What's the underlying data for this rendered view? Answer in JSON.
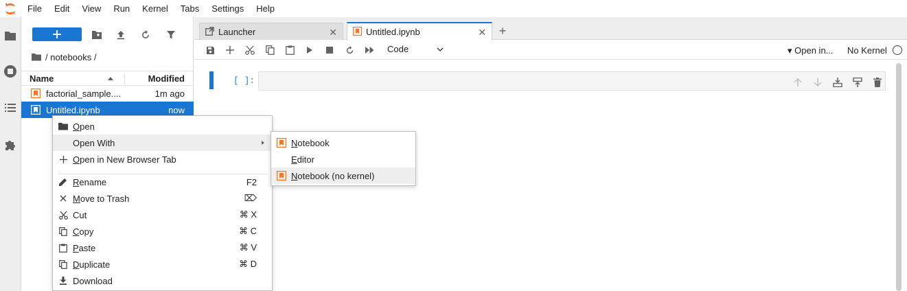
{
  "menubar": {
    "items": [
      "File",
      "Edit",
      "View",
      "Run",
      "Kernel",
      "Tabs",
      "Settings",
      "Help"
    ]
  },
  "activity_bar": {
    "icons": [
      "folder-icon",
      "running-icon",
      "toc-icon",
      "extension-icon"
    ]
  },
  "filebrowser": {
    "new_button_icon": "plus-icon",
    "toolbar_icons": [
      "new-folder-icon",
      "upload-icon",
      "refresh-icon",
      "filter-icon"
    ],
    "breadcrumb": "/ notebooks /",
    "columns": {
      "name": "Name",
      "modified": "Modified"
    },
    "files": [
      {
        "name": "factorial_sample....",
        "modified": "1m ago",
        "selected": false
      },
      {
        "name": "Untitled.ipynb",
        "modified": "now",
        "selected": true
      }
    ]
  },
  "tabs": [
    {
      "label": "Launcher",
      "icon": "launcher-icon",
      "active": false
    },
    {
      "label": "Untitled.ipynb",
      "icon": "notebook-icon",
      "active": true
    }
  ],
  "notebook_toolbar": {
    "cell_type": "Code",
    "open_in": "Open in...",
    "kernel": "No Kernel"
  },
  "cell": {
    "prompt": "[ ]:"
  },
  "context_menu": {
    "items": [
      {
        "label": "Open",
        "mnemonic": "O",
        "rest": "pen",
        "icon": "folder-icon",
        "shortcut": ""
      },
      {
        "label": "Open With",
        "mnemonic": "",
        "rest": "Open With",
        "icon": "",
        "shortcut": "",
        "submenu": true
      },
      {
        "label": "Open in New Browser Tab",
        "mnemonic": "O",
        "rest": "pen in New Browser Tab",
        "icon": "plus-icon",
        "shortcut": ""
      },
      {
        "label": "Rename",
        "mnemonic": "R",
        "rest": "ename",
        "icon": "pencil-icon",
        "shortcut": "F2"
      },
      {
        "label": "Move to Trash",
        "mnemonic": "M",
        "rest": "ove to Trash",
        "icon": "close-icon",
        "shortcut": "⌦"
      },
      {
        "label": "Cut",
        "mnemonic": "",
        "rest": "Cut",
        "icon": "cut-icon",
        "shortcut": "⌘ X"
      },
      {
        "label": "Copy",
        "mnemonic": "C",
        "rest": "opy",
        "icon": "copy-icon",
        "shortcut": "⌘ C"
      },
      {
        "label": "Paste",
        "mnemonic": "P",
        "rest": "aste",
        "icon": "paste-icon",
        "shortcut": "⌘ V"
      },
      {
        "label": "Duplicate",
        "mnemonic": "D",
        "rest": "uplicate",
        "icon": "duplicate-icon",
        "shortcut": "⌘ D"
      },
      {
        "label": "Download",
        "mnemonic": "",
        "rest": "Download",
        "icon": "download-icon",
        "shortcut": ""
      }
    ]
  },
  "submenu": {
    "items": [
      {
        "mnemonic": "N",
        "rest": "otebook",
        "icon": "notebook-icon"
      },
      {
        "mnemonic": "E",
        "rest": "ditor",
        "icon": ""
      },
      {
        "mnemonic": "N",
        "rest": "otebook (no kernel)",
        "icon": "notebook-icon"
      }
    ]
  },
  "colors": {
    "accent": "#1976d2",
    "notebook_orange": "#f37726",
    "prompt_blue": "#307fc1"
  }
}
